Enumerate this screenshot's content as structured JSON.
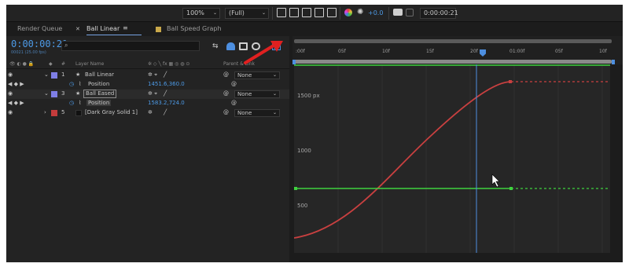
{
  "toolbar": {
    "zoom": "100%",
    "resolution": "(Full)",
    "exposure": "+0.0",
    "current_time": "0:00:00:21"
  },
  "tabs": [
    {
      "label": "Render Queue"
    },
    {
      "label": "Ball Linear"
    },
    {
      "label": "Ball Speed Graph"
    }
  ],
  "comp": {
    "timecode": "0:00:00:21",
    "fps_text": "00021 (25.00 fps)",
    "columns": {
      "layer_name": "Layer Name",
      "parent_link": "Parent & Link"
    },
    "layers": [
      {
        "num": "1",
        "name": "Ball Linear",
        "color": "#7f7fe6",
        "parent": "None"
      },
      {
        "prop": "Position",
        "value": "1451.6,360.0"
      },
      {
        "num": "3",
        "name": "Ball Eased",
        "color": "#7f7fe6",
        "parent": "None"
      },
      {
        "prop": "Position",
        "value": "1583.2,724.0"
      },
      {
        "num": "5",
        "name": "[Dark Gray Solid 1]",
        "color": "#c43c3c",
        "parent": "None"
      }
    ]
  },
  "graph": {
    "ruler_labels": [
      ":00f",
      "05f",
      "10f",
      "15f",
      "20f",
      "01:00f",
      "05f",
      "10f"
    ],
    "value_labels": [
      "1500 px",
      "1000",
      "500"
    ],
    "colors": {
      "eased_curve": "#c94040",
      "linear_curve": "#3fd23f",
      "playhead": "#4d8fe0",
      "annotation_arrow": "#e02020"
    }
  }
}
